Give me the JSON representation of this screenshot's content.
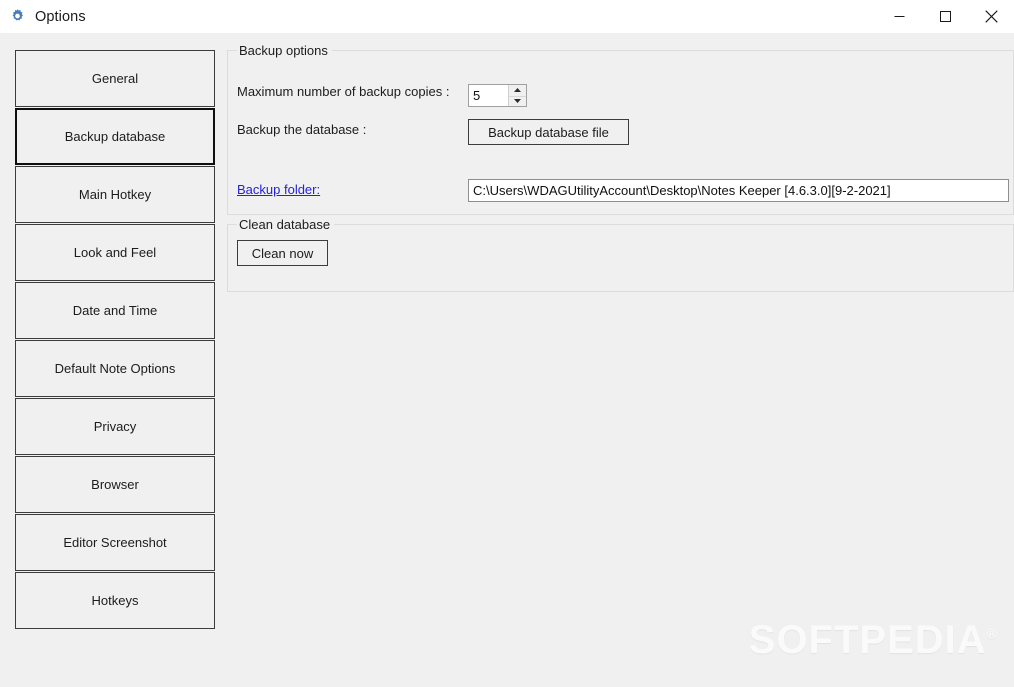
{
  "window": {
    "title": "Options",
    "icon": "gear-icon",
    "controls": {
      "minimize": "–",
      "maximize": "□",
      "close": "✕"
    }
  },
  "sidebar": {
    "items": [
      {
        "label": "General",
        "selected": false
      },
      {
        "label": "Backup database",
        "selected": true
      },
      {
        "label": "Main Hotkey",
        "selected": false
      },
      {
        "label": "Look and Feel",
        "selected": false
      },
      {
        "label": "Date and Time",
        "selected": false
      },
      {
        "label": "Default Note Options",
        "selected": false
      },
      {
        "label": "Privacy",
        "selected": false
      },
      {
        "label": "Browser",
        "selected": false
      },
      {
        "label": "Editor Screenshot",
        "selected": false
      },
      {
        "label": "Hotkeys",
        "selected": false
      }
    ]
  },
  "main": {
    "backup_options": {
      "group_title": "Backup options",
      "max_copies_label": "Maximum number of backup copies :",
      "max_copies_value": "5",
      "backup_db_label": "Backup the database :",
      "backup_db_button": "Backup database file",
      "backup_folder_link": "Backup folder:",
      "backup_folder_path": "C:\\Users\\WDAGUtilityAccount\\Desktop\\Notes Keeper [4.6.3.0][9-2-2021]"
    },
    "clean_database": {
      "group_title": "Clean database",
      "clean_now_button": "Clean now"
    }
  },
  "watermark": {
    "text": "SOFTPEDIA",
    "mark": "®"
  },
  "colors": {
    "window_background": "#f0f0f0",
    "titlebar_background": "#ffffff",
    "button_border": "#3c3c3c",
    "selected_button_border": "#0f0f0f",
    "link": "#2222dd",
    "gear_icon": "#4a7ebb",
    "groupbox_border": "#dcdcdc",
    "field_background": "#ffffff"
  }
}
